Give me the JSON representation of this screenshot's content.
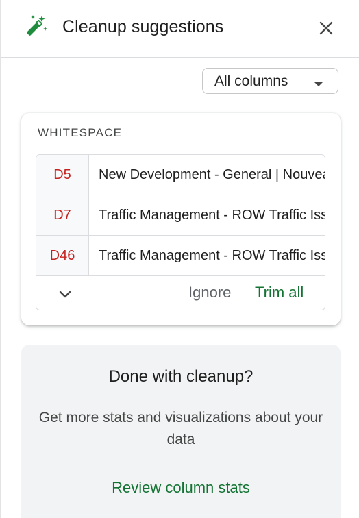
{
  "header": {
    "title": "Cleanup suggestions",
    "icon": "magic-wand-icon",
    "close_icon": "close-icon"
  },
  "filter": {
    "selected": "All columns",
    "caret_icon": "caret-down-icon"
  },
  "whitespace_card": {
    "section_label": "WHITESPACE",
    "rows": [
      {
        "ref": "D5",
        "value": "New Development - General | Nouveau développement"
      },
      {
        "ref": "D7",
        "value": "Traffic Management - ROW Traffic Issues"
      },
      {
        "ref": "D46",
        "value": "Traffic Management - ROW Traffic Issues"
      }
    ],
    "expand_icon": "chevron-down-icon",
    "ignore_label": "Ignore",
    "trim_label": "Trim all"
  },
  "done_card": {
    "title": "Done with cleanup?",
    "description": "Get more stats and visualizations about your data",
    "link_label": "Review column stats"
  },
  "colors": {
    "accent_green": "#137333",
    "ref_red": "#c5221f",
    "wand_green": "#1e8e3e"
  }
}
